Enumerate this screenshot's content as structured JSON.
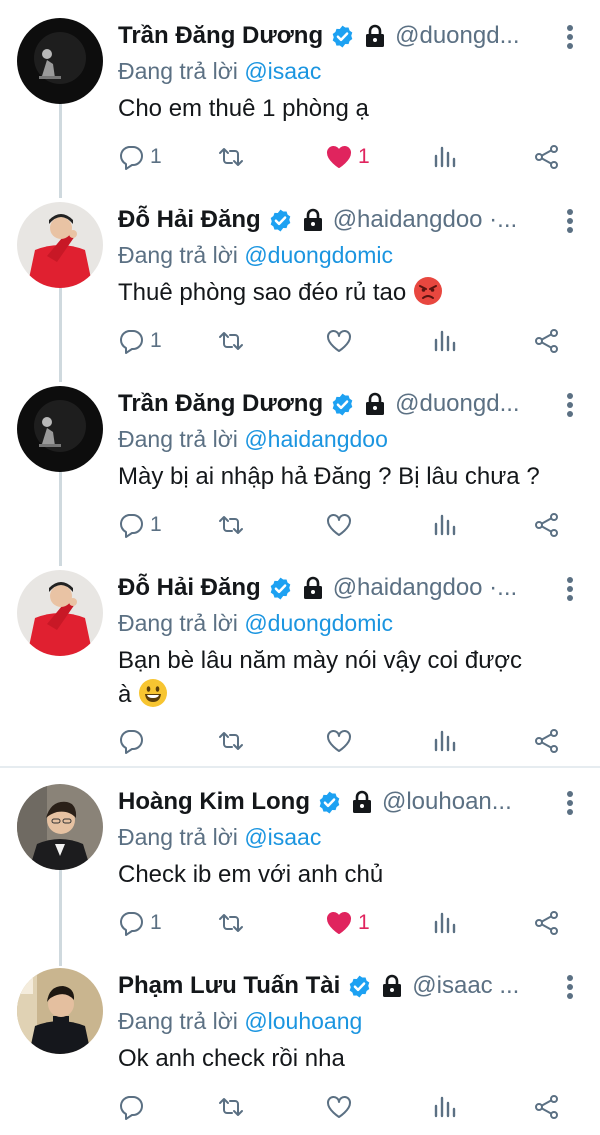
{
  "replies": [
    {
      "name": "Trần Đăng Dương",
      "handle": "@duongd...",
      "replying_label": "Đang trả lời ",
      "replying_to": "@isaac",
      "text": "Cho em thuê 1 phòng ạ",
      "reply_count": "1",
      "like_count": "1",
      "liked": true,
      "avatar": "dark-portrait"
    },
    {
      "name": "Đỗ Hải Đăng",
      "handle": "@haidangdoo ·...",
      "replying_label": "Đang trả lời ",
      "replying_to": "@duongdomic",
      "text": "Thuê phòng sao đéo rủ tao",
      "emoji": "angry-face-emoji",
      "reply_count": "1",
      "like_count": "",
      "liked": false,
      "avatar": "red-suit-portrait"
    },
    {
      "name": "Trần Đăng Dương",
      "handle": "@duongd...",
      "replying_label": "Đang trả lời ",
      "replying_to": "@haidangdoo",
      "text": "Mày bị ai nhập hả Đăng ? Bị lâu chưa ?",
      "reply_count": "1",
      "like_count": "",
      "liked": false,
      "avatar": "dark-portrait"
    },
    {
      "name": "Đỗ Hải Đăng",
      "handle": "@haidangdoo ·...",
      "replying_label": "Đang trả lời ",
      "replying_to": "@duongdomic",
      "text_line1": "Bạn bè lâu năm mày nói vậy coi được",
      "text_line2": "à",
      "emoji": "grinning-face-emoji",
      "reply_count": "",
      "like_count": "",
      "liked": false,
      "avatar": "red-suit-portrait"
    },
    {
      "name": "Hoàng Kim Long",
      "handle": "@louhoan...",
      "replying_label": "Đang trả lời ",
      "replying_to": "@isaac",
      "text": "Check ib em với anh chủ",
      "reply_count": "1",
      "like_count": "1",
      "liked": true,
      "avatar": "suit-portrait"
    },
    {
      "name": "Phạm Lưu Tuấn Tài",
      "handle": "@isaac ...",
      "replying_label": "Đang trả lời ",
      "replying_to": "@louhoang",
      "text": "Ok anh check rồi nha",
      "reply_count": "",
      "like_count": "",
      "liked": false,
      "avatar": "black-turtleneck-portrait"
    }
  ],
  "colors": {
    "verified": "#1da1f2",
    "mention": "#1b95e0",
    "secondary_text": "#5b7083",
    "like_active": "#e0245e",
    "thread_line": "#cfd9de"
  },
  "icons": [
    "verified-badge-icon",
    "lock-icon",
    "more-options-icon",
    "reply-icon",
    "retweet-icon",
    "like-icon",
    "stats-icon",
    "share-icon"
  ]
}
